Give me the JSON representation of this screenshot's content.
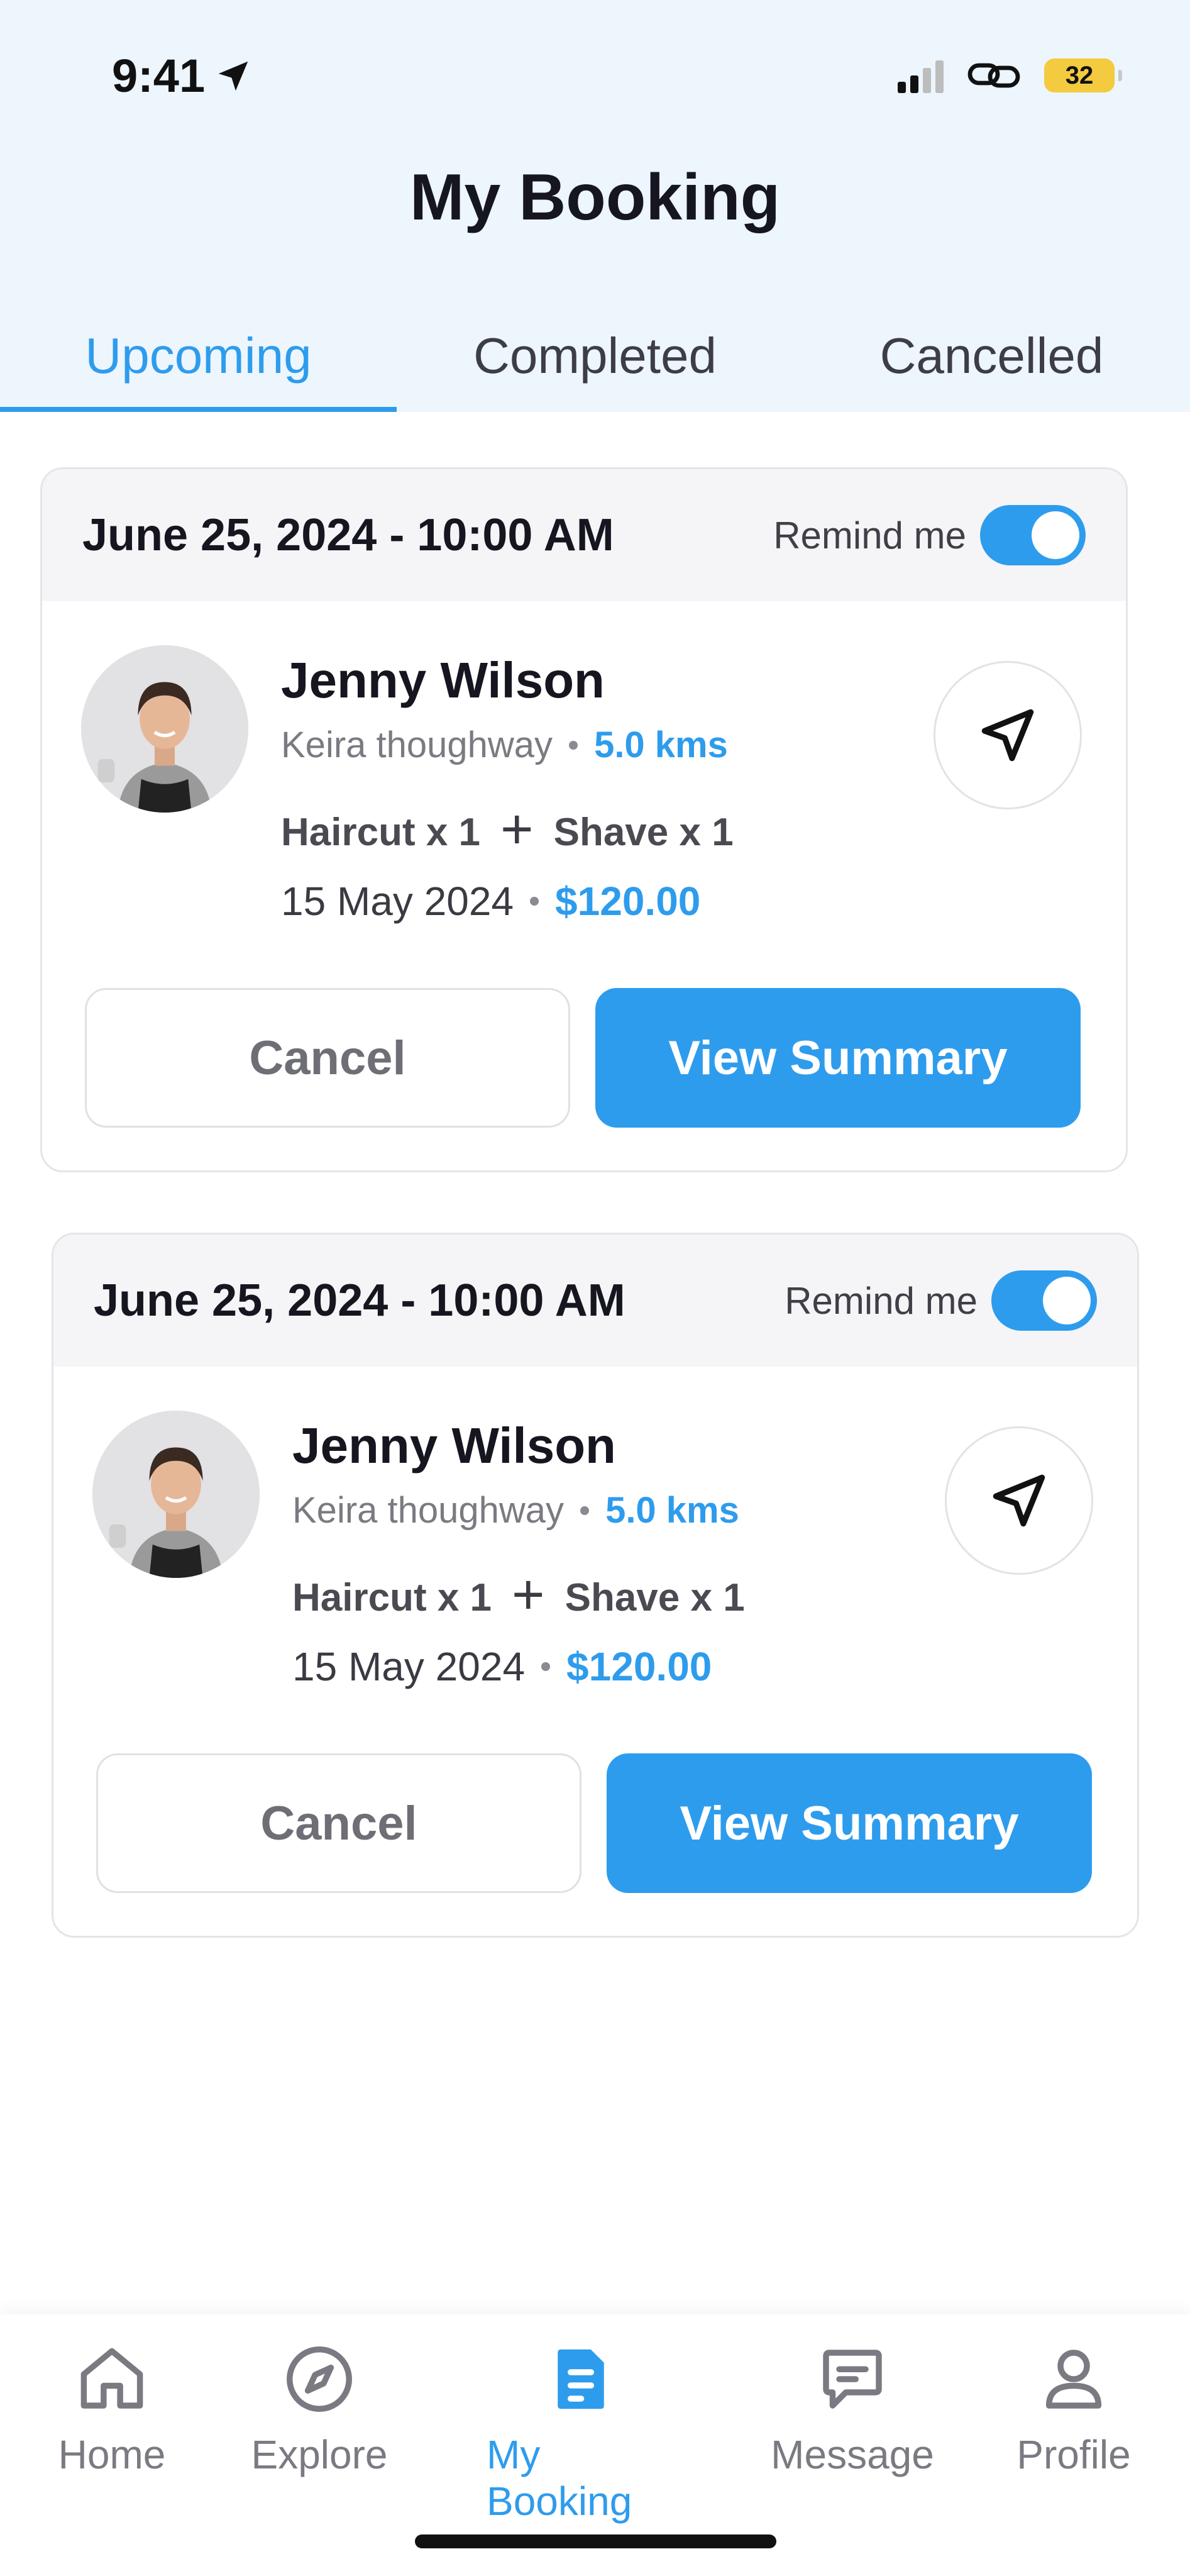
{
  "status_bar": {
    "time": "9:41",
    "battery": "32"
  },
  "header": {
    "title": "My Booking"
  },
  "tabs": [
    {
      "label": "Upcoming",
      "active": true
    },
    {
      "label": "Completed",
      "active": false
    },
    {
      "label": "Cancelled",
      "active": false
    }
  ],
  "bookings": [
    {
      "date": "June 25, 2024 - 10:00 AM",
      "remind_label": "Remind me",
      "remind_on": true,
      "name": "Jenny Wilson",
      "address": "Keira thoughway",
      "distance": "5.0 kms",
      "service_1": "Haircut x 1",
      "service_2": "Shave x 1",
      "booking_date": "15 May 2024",
      "price": "$120.00",
      "cancel_label": "Cancel",
      "summary_label": "View Summary"
    },
    {
      "date": "June 25, 2024 - 10:00 AM",
      "remind_label": "Remind me",
      "remind_on": true,
      "name": "Jenny Wilson",
      "address": "Keira thoughway",
      "distance": "5.0 kms",
      "service_1": "Haircut x 1",
      "service_2": "Shave x 1",
      "booking_date": "15 May 2024",
      "price": "$120.00",
      "cancel_label": "Cancel",
      "summary_label": "View Summary"
    }
  ],
  "bottom_nav": [
    {
      "label": "Home",
      "icon": "home-icon",
      "active": false
    },
    {
      "label": "Explore",
      "icon": "compass-icon",
      "active": false
    },
    {
      "label": "My Booking",
      "icon": "document-icon",
      "active": true
    },
    {
      "label": "Message",
      "icon": "message-icon",
      "active": false
    },
    {
      "label": "Profile",
      "icon": "user-icon",
      "active": false
    }
  ],
  "colors": {
    "accent": "#2e9ced",
    "header_bg": "#edf5fd",
    "battery": "#f4cb3f"
  }
}
